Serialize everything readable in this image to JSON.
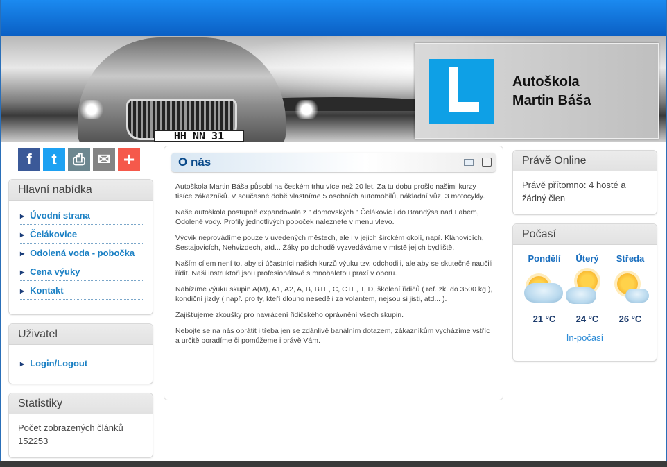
{
  "header": {
    "brand_line1": "Autoškola",
    "brand_line2": "Martin Báša",
    "plate": "HH NN 31",
    "accent": "#0ea0e6"
  },
  "social": [
    {
      "name": "facebook",
      "glyph": "f",
      "color": "#3b5998"
    },
    {
      "name": "twitter",
      "glyph": "t",
      "color": "#1da1f2"
    },
    {
      "name": "print",
      "glyph": "⎙",
      "color": "#6d8790"
    },
    {
      "name": "email",
      "glyph": "✉",
      "color": "#848484"
    },
    {
      "name": "more",
      "glyph": "+",
      "color": "#f5594b"
    }
  ],
  "main_menu": {
    "title": "Hlavní nabídka",
    "items": [
      {
        "label": "Úvodní strana"
      },
      {
        "label": "Čelákovice"
      },
      {
        "label": "Odolená voda - pobočka"
      },
      {
        "label": "Cena výuky"
      },
      {
        "label": "Kontakt"
      }
    ]
  },
  "user": {
    "title": "Uživatel",
    "login_label": "Login/Logout"
  },
  "stats": {
    "title": "Statistiky",
    "line1": "Počet zobrazených článků",
    "count": "152253"
  },
  "article": {
    "title": "O nás",
    "paragraphs": [
      "Autoškola Martin Báša působí na českém trhu více než 20 let. Za tu dobu prošlo našimi kurzy tisíce zákazníků. V současné době vlastníme 5 osobních automobilů,  nákladní  vůz, 3 motocykly.",
      "Naše autoškola postupně expandovala z \" domovských \" Čelákovic i do Brandýsa nad Labem, Odolené vody. Profily jednotlivých poboček naleznete v menu vlevo.",
      "Výcvik neprovádíme pouze v uvedených městech, ale i v jejich širokém okolí, např. Klánovicích, Šestajovicích, Nehvizdech, atd... Žáky po dohodě vyzvedáváme v místě jejich bydliště.",
      "Naším cílem není to, aby si účastníci našich kurzů výuku tzv. odchodili, ale aby se skutečně naučili řídit. Naši instruktoři jsou profesionálové s mnohaletou praxí v oboru.",
      "Nabízíme výuku skupin A(M), A1, A2, A, B, B+E, C, C+E, T, D, školení řidičů ( ref. zk. do 3500 kg ), kondiční jízdy ( např. pro ty, kteří dlouho neseděli za volantem, nejsou si jisti, atd... ).",
      "Zajišťujeme zkoušky pro navrácení řidičského oprávnění všech skupin.",
      "Nebojte se na nás obrátit i třeba jen se zdánlivě banálním dotazem, zákazníkům vycházíme vstříc a určitě poradíme či pomůžeme i právě Vám."
    ]
  },
  "online": {
    "title": "Právě Online",
    "text": "Právě přítomno: 4 hosté a žádný člen"
  },
  "weather": {
    "title": "Počasí",
    "days": [
      {
        "day": "Pondělí",
        "temp": "21 °C",
        "icon": "cloud-sun-icon"
      },
      {
        "day": "Úterý",
        "temp": "24 °C",
        "icon": "sun-cloud-icon"
      },
      {
        "day": "Středa",
        "temp": "26 °C",
        "icon": "sun-cloud-icon"
      }
    ],
    "link": "In-počasí"
  }
}
